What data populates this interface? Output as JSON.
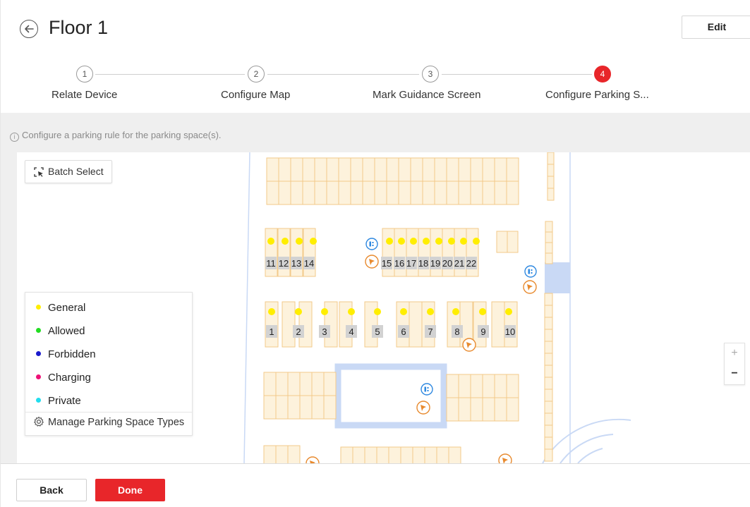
{
  "header": {
    "title": "Floor 1",
    "edit_label": "Edit"
  },
  "steps": [
    {
      "number": "1",
      "label": "Relate Device",
      "state": "done"
    },
    {
      "number": "2",
      "label": "Configure Map",
      "state": "done"
    },
    {
      "number": "3",
      "label": "Mark Guidance Screen",
      "state": "done"
    },
    {
      "number": "4",
      "label": "Configure Parking S...",
      "state": "active"
    }
  ],
  "hint": {
    "icon": "info-icon",
    "text": "Configure a parking rule for the parking space(s)."
  },
  "toolbar": {
    "batch_select_label": "Batch Select",
    "batch_select_icon": "select-cursor-icon"
  },
  "legend": {
    "items": [
      {
        "label": "General",
        "color": "#ffee00"
      },
      {
        "label": "Allowed",
        "color": "#22dd22"
      },
      {
        "label": "Forbidden",
        "color": "#1a1acc"
      },
      {
        "label": "Charging",
        "color": "#ee1177"
      },
      {
        "label": "Private",
        "color": "#22ddee"
      }
    ],
    "manage_label": "Manage Parking Space Types",
    "manage_icon": "gear-icon"
  },
  "map": {
    "space_numbers_row1": [
      "11",
      "12",
      "13",
      "14",
      "15",
      "16",
      "17",
      "18",
      "19",
      "20",
      "21",
      "22"
    ],
    "space_numbers_row2": [
      "1",
      "2",
      "3",
      "4",
      "5",
      "6",
      "7",
      "8",
      "9",
      "10"
    ],
    "marker_icons": [
      "guidance-screen-icon",
      "camera-icon"
    ]
  },
  "zoom": {
    "in_label": "+",
    "out_label": "−"
  },
  "footer": {
    "back_label": "Back",
    "done_label": "Done"
  },
  "colors": {
    "accent": "#e8262a",
    "space_fill": "#fdf2dc",
    "space_stroke": "#f2c98a",
    "wall": "#c9d9f5",
    "general_dot": "#ffee00"
  }
}
